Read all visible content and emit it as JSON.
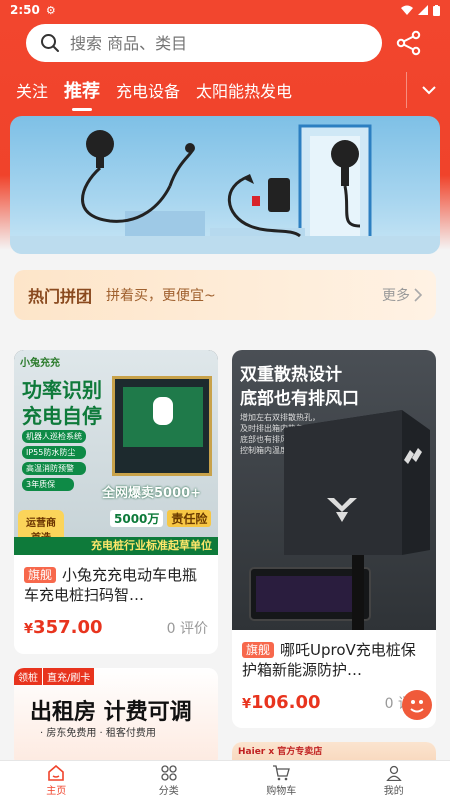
{
  "status": {
    "time": "2:50"
  },
  "search": {
    "placeholder": "搜索 商品、类目"
  },
  "tabs": [
    {
      "label": "关注",
      "active": false
    },
    {
      "label": "推荐",
      "active": true
    },
    {
      "label": "充电设备",
      "active": false
    },
    {
      "label": "太阳能热发电",
      "active": false
    }
  ],
  "group": {
    "title": "热门拼团",
    "subtitle": "拼着买，更便宜~",
    "more": "更多"
  },
  "products": [
    {
      "badge": "旗舰",
      "title": "小兔充充电动车电瓶车充电桩扫码智…",
      "currency": "¥",
      "price": "357.00",
      "reviews": "0 评价",
      "image": {
        "brand": "小兔充充",
        "headline1": "功率识别",
        "headline2": "充电自停",
        "features": [
          "机器人巡检系统",
          "IP55防水防尘",
          "高温消防预警",
          "3年质保"
        ],
        "sales": "全网爆卖5000+",
        "sales_unit": "5000万",
        "insurance": "责任险",
        "stamp1": "运营商",
        "stamp2": "首选",
        "footer": "充电桩行业标准起草单位"
      }
    },
    {
      "badge": "旗舰",
      "title": "哪吒UproV充电桩保护箱新能源防护…",
      "currency": "¥",
      "price": "106.00",
      "reviews": "0 评价",
      "image": {
        "headline1": "双重散热设计",
        "headline2": "底部也有排风口",
        "desc1": "增加左右双排散热孔，",
        "desc2": "及时排出箱内热气",
        "desc3": "底部也有排风口，",
        "desc4": "控制箱内温度"
      }
    },
    {
      "image": {
        "tag1": "领桩",
        "tag2": "直充/刷卡",
        "headline": "出租房 计费可调",
        "sub": "· 房东免费用 · 租客付费用"
      }
    },
    {
      "image": {
        "brand": "Haier x 官方专卖店"
      }
    }
  ],
  "nav": [
    {
      "label": "主页",
      "icon": "home-icon",
      "active": true
    },
    {
      "label": "分类",
      "icon": "category-icon",
      "active": false
    },
    {
      "label": "购物车",
      "icon": "cart-icon",
      "active": false
    },
    {
      "label": "我的",
      "icon": "profile-icon",
      "active": false
    }
  ],
  "colors": {
    "brand": "#f0432b",
    "price": "#e8341e",
    "badge": "#f7684c"
  }
}
